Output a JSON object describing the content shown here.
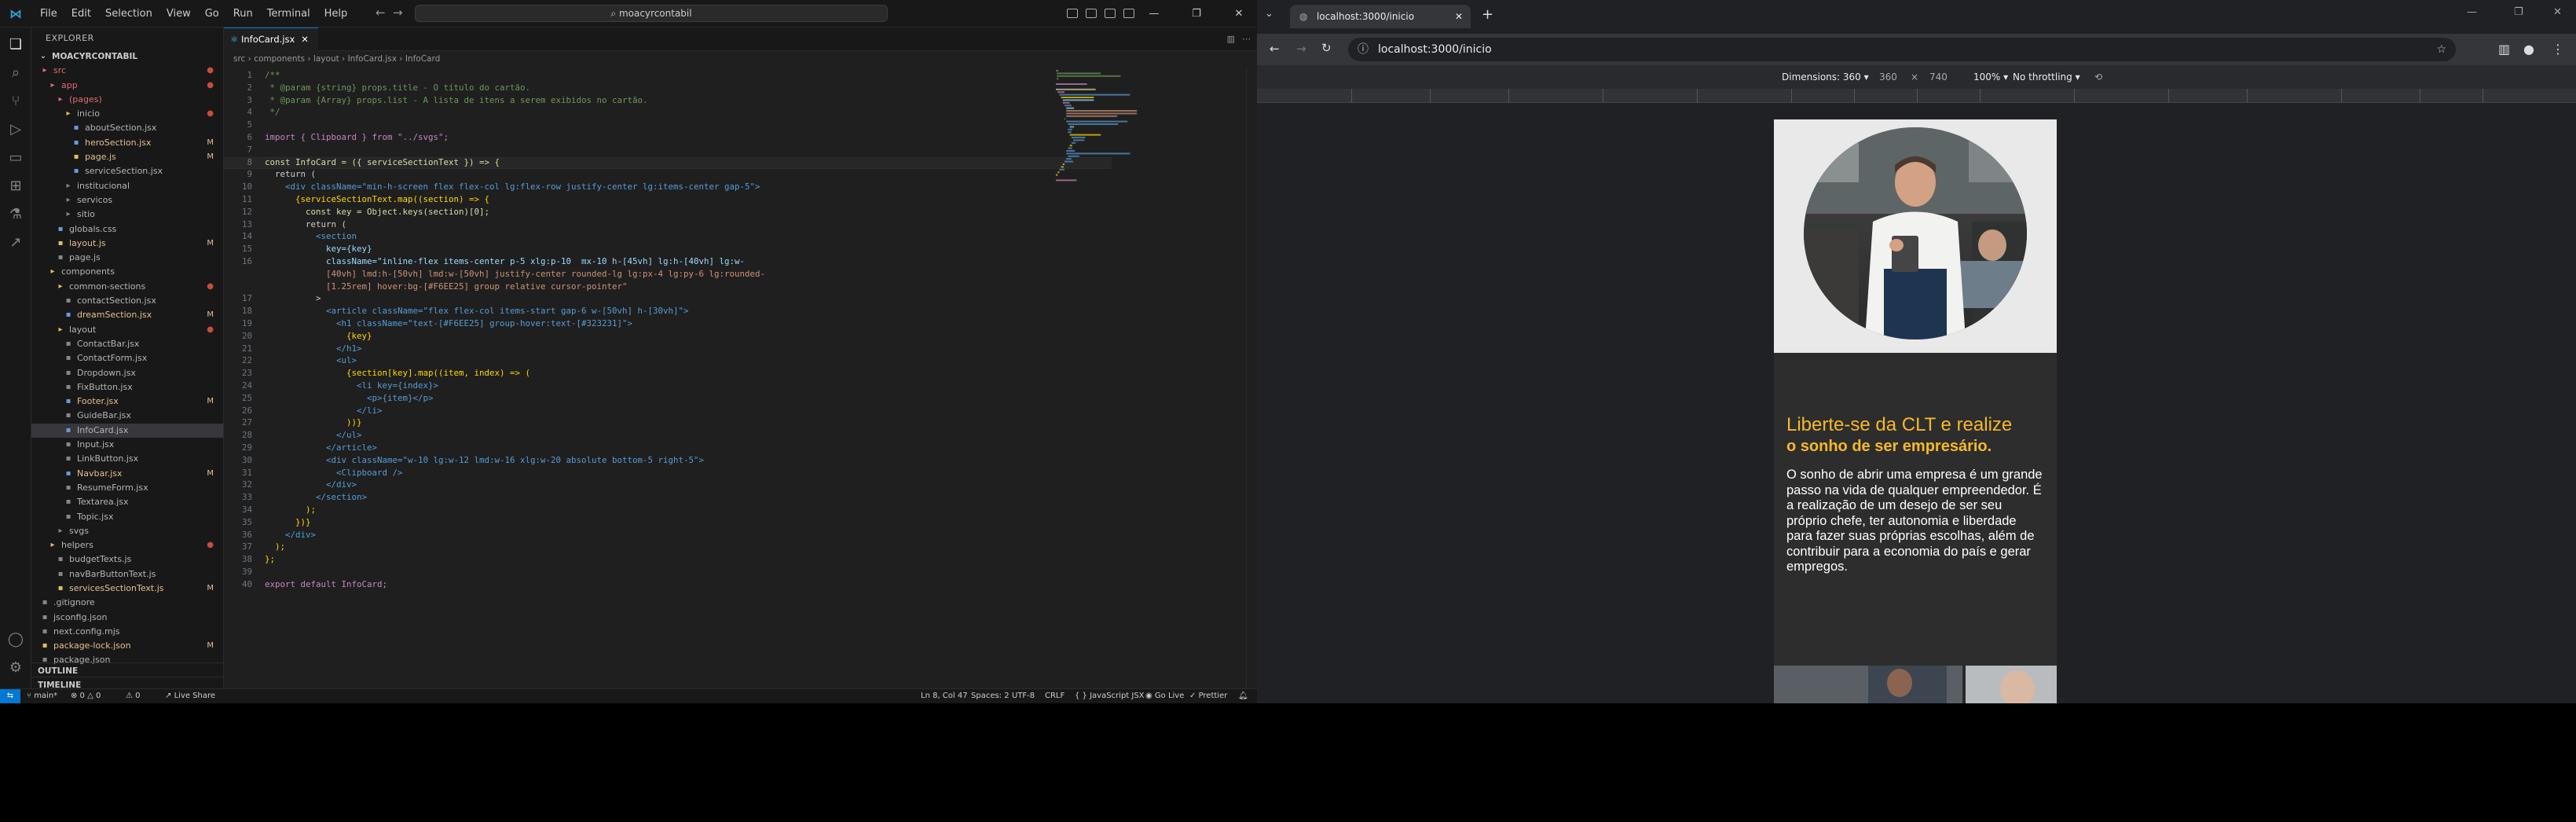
{
  "vscode": {
    "menu": [
      "File",
      "Edit",
      "Selection",
      "View",
      "Go",
      "Run",
      "Terminal",
      "Help"
    ],
    "command_center": "moacyrcontabil",
    "explorer_title": "EXPLORER",
    "project_root": "MOACYRCONTABIL",
    "tree": [
      {
        "label": "src",
        "type": "folder",
        "color": "#e06c75",
        "badge": "●"
      },
      {
        "label": "app",
        "type": "folder",
        "color": "#e06c75",
        "badge": "●"
      },
      {
        "label": "(pages)",
        "type": "folder",
        "color": "#e06c75",
        "badge": ""
      },
      {
        "label": "inicio",
        "type": "folder",
        "color": "#e0c05a",
        "badge": "●"
      },
      {
        "label": "aboutSection.jsx",
        "type": "file",
        "color": "#6a9bd8",
        "badge": ""
      },
      {
        "label": "heroSection.jsx",
        "type": "file",
        "color": "#6a9bd8",
        "badge": "M"
      },
      {
        "label": "page.js",
        "type": "file",
        "color": "#e0c05a",
        "badge": "M"
      },
      {
        "label": "serviceSection.jsx",
        "type": "file",
        "color": "#6a9bd8",
        "badge": ""
      },
      {
        "label": "institucional",
        "type": "folder",
        "color": "#888",
        "badge": ""
      },
      {
        "label": "servicos",
        "type": "folder",
        "color": "#888",
        "badge": ""
      },
      {
        "label": "sitio",
        "type": "folder",
        "color": "#888",
        "badge": ""
      },
      {
        "label": "globals.css",
        "type": "file",
        "color": "#6a9bd8",
        "badge": ""
      },
      {
        "label": "layout.js",
        "type": "file",
        "color": "#e0c05a",
        "badge": "M"
      },
      {
        "label": "page.js",
        "type": "file",
        "color": "#888",
        "badge": ""
      },
      {
        "label": "components",
        "type": "folder",
        "color": "#e0c05a",
        "badge": ""
      },
      {
        "label": "common-sections",
        "type": "folder",
        "color": "#e0c05a",
        "badge": "●"
      },
      {
        "label": "contactSection.jsx",
        "type": "file",
        "color": "#888",
        "badge": ""
      },
      {
        "label": "dreamSection.jsx",
        "type": "file",
        "color": "#6a9bd8",
        "badge": "M"
      },
      {
        "label": "layout",
        "type": "folder",
        "color": "#e0c05a",
        "badge": "●"
      },
      {
        "label": "ContactBar.jsx",
        "type": "file",
        "color": "#888",
        "badge": ""
      },
      {
        "label": "ContactForm.jsx",
        "type": "file",
        "color": "#888",
        "badge": ""
      },
      {
        "label": "Dropdown.jsx",
        "type": "file",
        "color": "#888",
        "badge": ""
      },
      {
        "label": "FixButton.jsx",
        "type": "file",
        "color": "#888",
        "badge": ""
      },
      {
        "label": "Footer.jsx",
        "type": "file",
        "color": "#6a9bd8",
        "badge": "M"
      },
      {
        "label": "GuideBar.jsx",
        "type": "file",
        "color": "#888",
        "badge": ""
      },
      {
        "label": "InfoCard.jsx",
        "type": "file",
        "color": "#6a9bd8",
        "badge": ""
      },
      {
        "label": "Input.jsx",
        "type": "file",
        "color": "#888",
        "badge": ""
      },
      {
        "label": "LinkButton.jsx",
        "type": "file",
        "color": "#888",
        "badge": ""
      },
      {
        "label": "Navbar.jsx",
        "type": "file",
        "color": "#6a9bd8",
        "badge": "M"
      },
      {
        "label": "ResumeForm.jsx",
        "type": "file",
        "color": "#888",
        "badge": ""
      },
      {
        "label": "Textarea.jsx",
        "type": "file",
        "color": "#888",
        "badge": ""
      },
      {
        "label": "Topic.jsx",
        "type": "file",
        "color": "#888",
        "badge": ""
      },
      {
        "label": "svgs",
        "type": "folder",
        "color": "#888",
        "badge": ""
      },
      {
        "label": "helpers",
        "type": "folder",
        "color": "#e0c05a",
        "badge": "●"
      },
      {
        "label": "budgetTexts.js",
        "type": "file",
        "color": "#888",
        "badge": ""
      },
      {
        "label": "navBarButtonText.js",
        "type": "file",
        "color": "#888",
        "badge": ""
      },
      {
        "label": "servicesSectionText.js",
        "type": "file",
        "color": "#e0c05a",
        "badge": "M"
      },
      {
        "label": ".gitignore",
        "type": "file",
        "color": "#888",
        "badge": ""
      },
      {
        "label": "jsconfig.json",
        "type": "file",
        "color": "#888",
        "badge": ""
      },
      {
        "label": "next.config.mjs",
        "type": "file",
        "color": "#888",
        "badge": ""
      },
      {
        "label": "package-lock.json",
        "type": "file",
        "color": "#e0c05a",
        "badge": "M"
      },
      {
        "label": "package.json",
        "type": "file",
        "color": "#888",
        "badge": ""
      }
    ],
    "outline_label": "OUTLINE",
    "timeline_label": "TIMELINE",
    "active_tab": "InfoCard.jsx",
    "breadcrumb": "src › components › layout › InfoCard.jsx › InfoCard",
    "code_lines": [
      "/**",
      " * @param {string} props.title - O título do cartão.",
      " * @param {Array} props.list - A lista de itens a serem exibidos no cartão.",
      " */",
      "",
      "import { Clipboard } from \"../svgs\";",
      "",
      "const InfoCard = ({ serviceSectionText }) => {",
      "  return (",
      "    <div className=\"min-h-screen flex flex-col lg:flex-row justify-center lg:items-center gap-5\">",
      "      {serviceSectionText.map((section) => {",
      "        const key = Object.keys(section)[0];",
      "        return (",
      "          <section",
      "            key={key}",
      "            className=\"inline-flex items-center p-5 xlg:p-10  mx-10 h-[45vh] lg:h-[40vh] lg:w-",
      "            [40vh] lmd:h-[50vh] lmd:w-[50vh] justify-center rounded-lg lg:px-4 lg:py-6 lg:rounded-",
      "            [1.25rem] hover:bg-[#F6EE25] group relative cursor-pointer\"",
      "          >",
      "            <article className=\"flex flex-col items-start gap-6 w-[50vh] h-[30vh]\">",
      "              <h1 className=\"text-[#F6EE25] group-hover:text-[#323231]\">",
      "                {key}",
      "              </h1>",
      "              <ul>",
      "                {section[key].map((item, index) => (",
      "                  <li key={index}>",
      "                    <p>{item}</p>",
      "                  </li>",
      "                ))}",
      "              </ul>",
      "            </article>",
      "            <div className=\"w-10 lg:w-12 lmd:w-16 xlg:w-20 absolute bottom-5 right-5\">",
      "              <Clipboard />",
      "            </div>",
      "          </section>",
      "        );",
      "      })}",
      "    </div>",
      "  );",
      "};",
      "",
      "export default InfoCard;"
    ],
    "line_numbers": [
      "1",
      "2",
      "3",
      "4",
      "5",
      "6",
      "7",
      "8",
      "9",
      "10",
      "11",
      "12",
      "13",
      "14",
      "15",
      "16",
      "",
      "",
      "17",
      "18",
      "19",
      "20",
      "21",
      "22",
      "23",
      "24",
      "25",
      "26",
      "27",
      "28",
      "29",
      "30",
      "31",
      "32",
      "33",
      "34",
      "35",
      "36",
      "37",
      "38",
      "39",
      "40",
      "41"
    ],
    "status_left": [
      "main*",
      "⊗ 0  △ 0",
      "⚠ 0",
      "Live Share"
    ],
    "status_right": [
      "Ln 8, Col 47",
      "Spaces: 2",
      "UTF-8",
      "CRLF",
      "{ } JavaScript JSX",
      "Go Live",
      "Prettier"
    ]
  },
  "browser": {
    "tab_title": "localhost:3000/inicio",
    "url": "localhost:3000/inicio",
    "devtools": {
      "dimensions_label": "Dimensions: 360",
      "width": "360",
      "times": "×",
      "height": "740",
      "zoom": "100%",
      "throttle": "No throttling"
    },
    "page": {
      "headline_1": "Liberte-se da CLT e realize",
      "headline_2": "o sonho de ser empresário.",
      "body": "O sonho de abrir uma empresa é um grande passo na vida de qualquer empreendedor. É a realização de um desejo de ser seu próprio chefe, ter autonomia e liberdade para fazer suas próprias escolhas, além de contribuir para a economia do país e gerar empregos.",
      "accent_color": "#F6B925"
    }
  }
}
